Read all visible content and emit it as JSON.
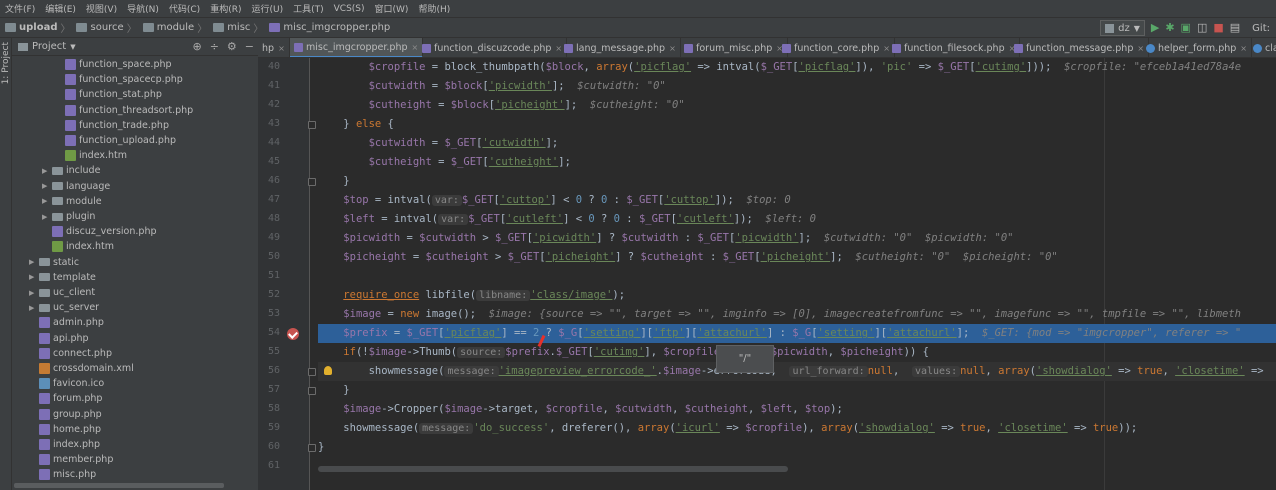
{
  "menu": [
    "文件(F)",
    "编辑(E)",
    "视图(V)",
    "导航(N)",
    "代码(C)",
    "重构(R)",
    "运行(U)",
    "工具(T)",
    "VCS(S)",
    "窗口(W)",
    "帮助(H)"
  ],
  "breadcrumb": [
    {
      "label": "upload",
      "bold": true
    },
    {
      "label": "source",
      "bold": false
    },
    {
      "label": "module",
      "bold": false
    },
    {
      "label": "misc",
      "bold": false
    },
    {
      "label": "misc_imgcropper.php",
      "bold": false
    }
  ],
  "toolbar": {
    "run_config": "dz",
    "git_label": "Git:"
  },
  "project_panel": {
    "title": "Project",
    "side_tab": "1: Project",
    "tree": [
      {
        "label": "function_space.php",
        "type": "php",
        "indent": 3,
        "arrow": ""
      },
      {
        "label": "function_spacecp.php",
        "type": "php",
        "indent": 3,
        "arrow": ""
      },
      {
        "label": "function_stat.php",
        "type": "php",
        "indent": 3,
        "arrow": ""
      },
      {
        "label": "function_threadsort.php",
        "type": "php",
        "indent": 3,
        "arrow": ""
      },
      {
        "label": "function_trade.php",
        "type": "php",
        "indent": 3,
        "arrow": ""
      },
      {
        "label": "function_upload.php",
        "type": "php",
        "indent": 3,
        "arrow": ""
      },
      {
        "label": "index.htm",
        "type": "htm",
        "indent": 3,
        "arrow": ""
      },
      {
        "label": "include",
        "type": "folder",
        "indent": 2,
        "arrow": "▶"
      },
      {
        "label": "language",
        "type": "folder",
        "indent": 2,
        "arrow": "▶"
      },
      {
        "label": "module",
        "type": "folder",
        "indent": 2,
        "arrow": "▶"
      },
      {
        "label": "plugin",
        "type": "folder",
        "indent": 2,
        "arrow": "▶"
      },
      {
        "label": "discuz_version.php",
        "type": "php",
        "indent": 2,
        "arrow": ""
      },
      {
        "label": "index.htm",
        "type": "htm",
        "indent": 2,
        "arrow": ""
      },
      {
        "label": "static",
        "type": "folder",
        "indent": 1,
        "arrow": "▶"
      },
      {
        "label": "template",
        "type": "folder",
        "indent": 1,
        "arrow": "▶"
      },
      {
        "label": "uc_client",
        "type": "folder",
        "indent": 1,
        "arrow": "▶"
      },
      {
        "label": "uc_server",
        "type": "folder",
        "indent": 1,
        "arrow": "▶"
      },
      {
        "label": "admin.php",
        "type": "php",
        "indent": 1,
        "arrow": ""
      },
      {
        "label": "api.php",
        "type": "php",
        "indent": 1,
        "arrow": ""
      },
      {
        "label": "connect.php",
        "type": "php",
        "indent": 1,
        "arrow": ""
      },
      {
        "label": "crossdomain.xml",
        "type": "xml",
        "indent": 1,
        "arrow": ""
      },
      {
        "label": "favicon.ico",
        "type": "ico",
        "indent": 1,
        "arrow": ""
      },
      {
        "label": "forum.php",
        "type": "php",
        "indent": 1,
        "arrow": ""
      },
      {
        "label": "group.php",
        "type": "php",
        "indent": 1,
        "arrow": ""
      },
      {
        "label": "home.php",
        "type": "php",
        "indent": 1,
        "arrow": ""
      },
      {
        "label": "index.php",
        "type": "php",
        "indent": 1,
        "arrow": ""
      },
      {
        "label": "member.php",
        "type": "php",
        "indent": 1,
        "arrow": ""
      },
      {
        "label": "misc.php",
        "type": "php",
        "indent": 1,
        "arrow": ""
      }
    ]
  },
  "tabs": [
    {
      "label": "hp",
      "icon": "php-file-icon",
      "active": false
    },
    {
      "label": "misc_imgcropper.php",
      "icon": "php-file-icon",
      "active": true
    },
    {
      "label": "function_discuzcode.php",
      "icon": "php-file-icon",
      "active": false
    },
    {
      "label": "lang_message.php",
      "icon": "php-file-icon",
      "active": false
    },
    {
      "label": "forum_misc.php",
      "icon": "php-file-icon",
      "active": false
    },
    {
      "label": "function_core.php",
      "icon": "php-file-icon",
      "active": false
    },
    {
      "label": "function_filesock.php",
      "icon": "php-file-icon",
      "active": false
    },
    {
      "label": "function_message.php",
      "icon": "php-file-icon",
      "active": false
    },
    {
      "label": "helper_form.php",
      "icon": "class-icon",
      "active": false
    },
    {
      "label": "cla",
      "icon": "class-icon",
      "active": false
    }
  ],
  "editor": {
    "line_numbers": [
      "40",
      "41",
      "42",
      "43",
      "44",
      "45",
      "46",
      "47",
      "48",
      "49",
      "50",
      "51",
      "52",
      "53",
      "54",
      "55",
      "56",
      "57",
      "58",
      "59",
      "60",
      "61"
    ],
    "breakpoint_line": "54",
    "highlight_line": "54",
    "current_line": "56",
    "tooltip": "\"/\""
  },
  "colors": {
    "accent": "#4a88c7",
    "breakpoint": "#c75450",
    "highlight": "#2d6099",
    "editor_bg": "#2b2b2b"
  }
}
